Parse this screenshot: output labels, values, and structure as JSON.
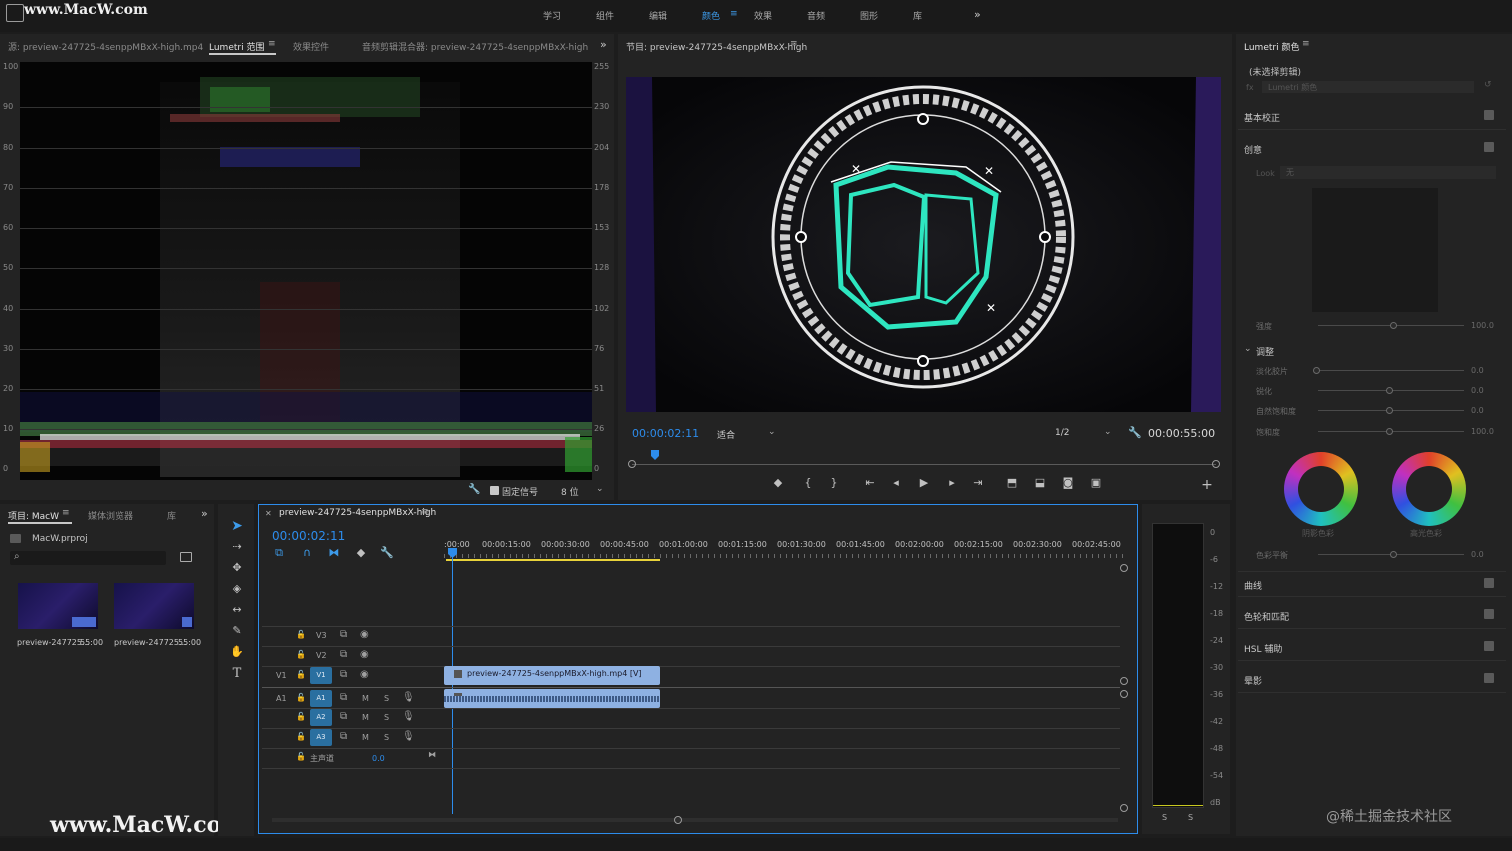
{
  "watermark_top": "www.MacW.com",
  "watermark_bottom": "www.MacW.com",
  "watermark_corner": "@稀土掘金技术社区",
  "workspaces": [
    "学习",
    "组件",
    "编辑",
    "颜色",
    "效果",
    "音频",
    "图形",
    "库"
  ],
  "workspace_more": "»",
  "source_panel": {
    "tabs": [
      "源: preview-247725-4senppMBxX-high.mp4",
      "Lumetri 范围",
      "效果控件",
      "音频剪辑混合器: preview-247725-4senppMBxX-high"
    ],
    "scale_left": [
      "100",
      "90",
      "80",
      "70",
      "60",
      "50",
      "40",
      "30",
      "20",
      "10",
      "0"
    ],
    "scale_right": [
      "255",
      "230",
      "204",
      "178",
      "153",
      "128",
      "102",
      "76",
      "51",
      "26",
      "0"
    ],
    "clamp_label": "固定信号",
    "bit_depth": "8 位"
  },
  "program_monitor": {
    "title": "节目: preview-247725-4senppMBxX-high",
    "timecode": "00:00:02:11",
    "fit": "适合",
    "resolution": "1/2",
    "duration": "00:00:55:00",
    "playback_progress": 0.04
  },
  "project_panel": {
    "tabs": [
      "项目: MacW",
      "媒体浏览器",
      "库"
    ],
    "file": "MacW.prproj",
    "items": [
      {
        "name": "preview-247725...",
        "duration": "55:00"
      },
      {
        "name": "preview-247725...",
        "duration": "55:00"
      }
    ]
  },
  "timeline": {
    "tab": "preview-247725-4senppMBxX-high",
    "timecode": "00:00:02:11",
    "ruler": [
      ":00:00",
      "00:00:15:00",
      "00:00:30:00",
      "00:00:45:00",
      "00:01:00:00",
      "00:01:15:00",
      "00:01:30:00",
      "00:01:45:00",
      "00:02:00:00",
      "00:02:15:00",
      "00:02:30:00",
      "00:02:45:00"
    ],
    "video_tracks": [
      {
        "src": "",
        "name": "V3"
      },
      {
        "src": "",
        "name": "V2"
      },
      {
        "src": "V1",
        "name": "V1"
      }
    ],
    "audio_tracks": [
      {
        "src": "A1",
        "name": "A1"
      },
      {
        "src": "",
        "name": "A2"
      },
      {
        "src": "",
        "name": "A3"
      }
    ],
    "mute": "M",
    "solo": "S",
    "master_label": "主声道",
    "master_value": "0.0",
    "clip_label": "preview-247725-4senppMBxX-high.mp4 [V]"
  },
  "meter": {
    "scale": [
      "0",
      "-6",
      "-12",
      "-18",
      "-24",
      "-30",
      "-36",
      "-42",
      "-48",
      "-54",
      "dB"
    ],
    "solo_buttons": [
      "S",
      "S"
    ]
  },
  "lumetri": {
    "title": "Lumetri 颜色",
    "clip": "(未选择剪辑)",
    "fx_label": "fx",
    "fx_value": "Lumetri 颜色",
    "sections_top": [
      "基本校正",
      "创意"
    ],
    "look_label": "Look",
    "look_value": "无",
    "intensity_label": "强度",
    "intensity_value": "100.0",
    "adjust_label": "调整",
    "sliders": [
      {
        "label": "淡化胶片",
        "value": "0.0",
        "pos": 0
      },
      {
        "label": "锐化",
        "value": "0.0",
        "pos": 0.5
      },
      {
        "label": "自然饱和度",
        "value": "0.0",
        "pos": 0.5
      },
      {
        "label": "饱和度",
        "value": "100.0",
        "pos": 0.5
      }
    ],
    "wheel_labels": [
      "阴影色彩",
      "高光色彩"
    ],
    "balance_label": "色彩平衡",
    "balance_value": "0.0",
    "sections_bottom": [
      "曲线",
      "色轮和匹配",
      "HSL 辅助",
      "晕影"
    ]
  }
}
